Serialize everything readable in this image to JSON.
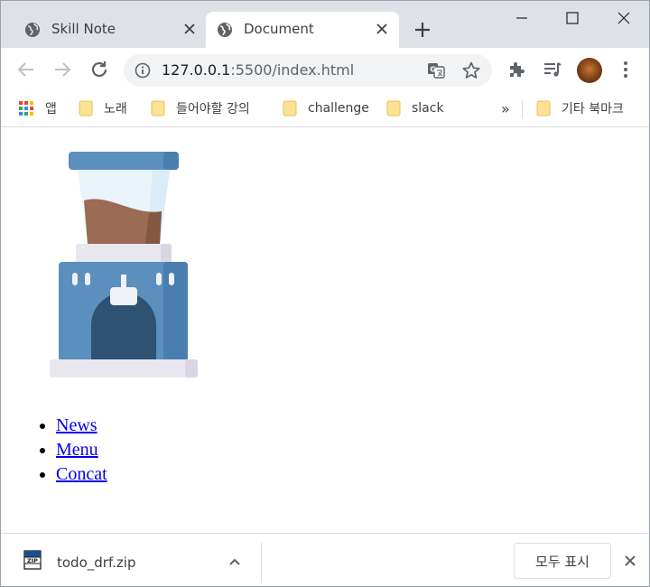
{
  "tabs": [
    {
      "title": "Skill Note",
      "active": false
    },
    {
      "title": "Document",
      "active": true
    }
  ],
  "toolbar": {
    "url_host": "127.0.0.1",
    "url_rest": ":5500/index.html"
  },
  "bookmarks": {
    "apps_label": "앱",
    "folders": [
      "노래",
      "들어야할 강의",
      "challenge",
      "slack"
    ],
    "overflow": "»",
    "other": "기타 북마크"
  },
  "page": {
    "image_icon": "coffee-grinder-icon",
    "menu": [
      "News",
      "Menu",
      "Concat"
    ]
  },
  "download_shelf": {
    "file_name": "todo_drf.zip",
    "show_all": "모두 표시"
  },
  "colors": {
    "tabstrip": "#dee1e6",
    "link": "#0000ee",
    "folder": "#fde293",
    "grinder_blue": "#5b8fbe",
    "grinder_dark": "#2e5272",
    "coffee": "#9c6b53"
  }
}
